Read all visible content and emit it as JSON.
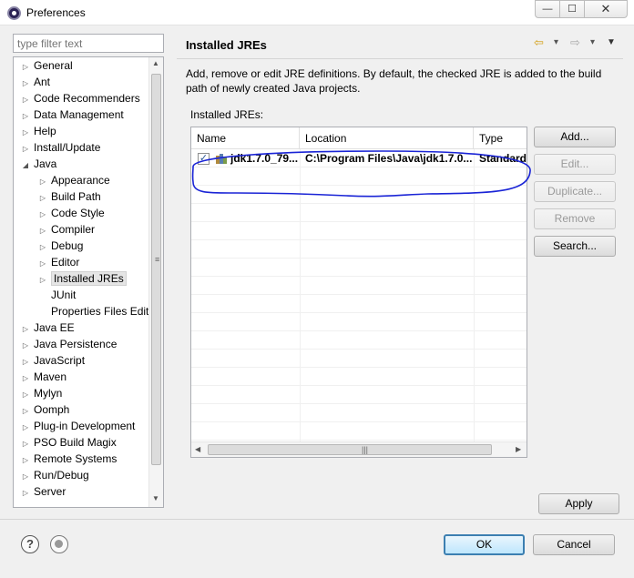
{
  "window": {
    "title": "Preferences",
    "minimize_glyph": "—",
    "maximize_glyph": "☐",
    "close_glyph": "✕"
  },
  "filter": {
    "placeholder": "type filter text"
  },
  "tree": {
    "items": [
      {
        "label": "General",
        "twisty": "▷"
      },
      {
        "label": "Ant",
        "twisty": "▷"
      },
      {
        "label": "Code Recommenders",
        "twisty": "▷"
      },
      {
        "label": "Data Management",
        "twisty": "▷"
      },
      {
        "label": "Help",
        "twisty": "▷"
      },
      {
        "label": "Install/Update",
        "twisty": "▷"
      },
      {
        "label": "Java",
        "twisty": "◢"
      },
      {
        "label": "Appearance",
        "twisty": "▷"
      },
      {
        "label": "Build Path",
        "twisty": "▷"
      },
      {
        "label": "Code Style",
        "twisty": "▷"
      },
      {
        "label": "Compiler",
        "twisty": "▷"
      },
      {
        "label": "Debug",
        "twisty": "▷"
      },
      {
        "label": "Editor",
        "twisty": "▷"
      },
      {
        "label": "Installed JREs",
        "twisty": "▷"
      },
      {
        "label": "JUnit",
        "twisty": ""
      },
      {
        "label": "Properties Files Edito",
        "twisty": ""
      },
      {
        "label": "Java EE",
        "twisty": "▷"
      },
      {
        "label": "Java Persistence",
        "twisty": "▷"
      },
      {
        "label": "JavaScript",
        "twisty": "▷"
      },
      {
        "label": "Maven",
        "twisty": "▷"
      },
      {
        "label": "Mylyn",
        "twisty": "▷"
      },
      {
        "label": "Oomph",
        "twisty": "▷"
      },
      {
        "label": "Plug-in Development",
        "twisty": "▷"
      },
      {
        "label": "PSO Build Magix",
        "twisty": "▷"
      },
      {
        "label": "Remote Systems",
        "twisty": "▷"
      },
      {
        "label": "Run/Debug",
        "twisty": "▷"
      },
      {
        "label": "Server",
        "twisty": "▷"
      }
    ]
  },
  "panel": {
    "title": "Installed JREs",
    "description": "Add, remove or edit JRE definitions. By default, the checked JRE is added to the build path of newly created Java projects.",
    "section_label": "Installed JREs:",
    "nav": {
      "back": "⇦",
      "dropdown": "▾",
      "forward": "⇨",
      "menu": "▼"
    }
  },
  "jre_table": {
    "columns": [
      "Name",
      "Location",
      "Type"
    ],
    "rows": [
      {
        "checked": "✓",
        "name": "jdk1.7.0_79...",
        "location": "C:\\Program Files\\Java\\jdk1.7.0...",
        "type": "Standard"
      }
    ]
  },
  "buttons": {
    "add": "Add...",
    "edit": "Edit...",
    "duplicate": "Duplicate...",
    "remove": "Remove",
    "search": "Search...",
    "apply": "Apply",
    "ok": "OK",
    "cancel": "Cancel"
  },
  "icons": {
    "help": "?",
    "scroll_up": "▲",
    "scroll_down": "▼",
    "scroll_left": "◀",
    "scroll_right": "▶",
    "grip_v": "≡",
    "grip_h": "|||"
  },
  "colors": {
    "annotation": "#1a24d6",
    "accent": "#3c7fb1"
  }
}
